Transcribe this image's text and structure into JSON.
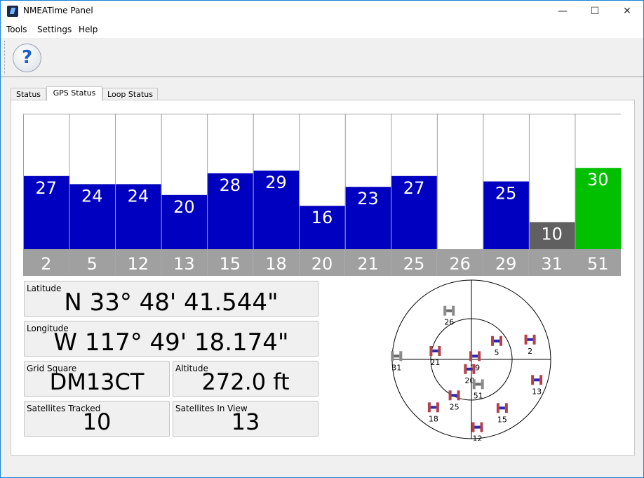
{
  "window": {
    "title": "NMEATime Panel",
    "controls": {
      "minimize": "—",
      "maximize": "☐",
      "close": "✕"
    }
  },
  "menu": {
    "tools": "Tools",
    "settings": "Settings",
    "help": "Help"
  },
  "toolbar": {
    "help_glyph": "?"
  },
  "tabs": [
    {
      "label": "Status"
    },
    {
      "label": "GPS Status"
    },
    {
      "label": "Loop Status"
    }
  ],
  "colors": {
    "bar_used": "#0000c0",
    "bar_tracked_unused": "#606060",
    "bar_selected": "#00c000",
    "prn_row": "#a0a0a0",
    "sat_used": "#b5414b",
    "sat_unused": "#8a8a8a"
  },
  "chart_data": {
    "type": "bar",
    "categories": [
      "2",
      "5",
      "12",
      "13",
      "15",
      "18",
      "20",
      "21",
      "25",
      "26",
      "29",
      "31",
      "51"
    ],
    "values": [
      27,
      24,
      24,
      20,
      28,
      29,
      16,
      23,
      27,
      0,
      25,
      10,
      30
    ],
    "value_labels": [
      "27",
      "24",
      "24",
      "20",
      "28",
      "29",
      "16",
      "23",
      "27",
      "",
      "25",
      "10",
      "30"
    ],
    "status": [
      "used",
      "used",
      "used",
      "used",
      "used",
      "used",
      "used",
      "used",
      "used",
      "none",
      "used",
      "tracked",
      "selected"
    ],
    "ylim": [
      0,
      50
    ]
  },
  "position": {
    "latitude_label": "Latitude",
    "latitude": "N 33° 48' 41.544\"",
    "longitude_label": "Longitude",
    "longitude": "W 117° 49' 18.174\"",
    "grid_label": "Grid Square",
    "grid": "DM13CT",
    "altitude_label": "Altitude",
    "altitude": "272.0 ft",
    "tracked_label": "Satellites Tracked",
    "tracked": "10",
    "inview_label": "Satellites In View",
    "inview": "13"
  },
  "skyplot": {
    "satellites": [
      {
        "prn": "26",
        "az": 335,
        "el": 30,
        "used": false
      },
      {
        "prn": "5",
        "az": 55,
        "el": 55,
        "used": true
      },
      {
        "prn": "2",
        "az": 72,
        "el": 20,
        "used": true
      },
      {
        "prn": "31",
        "az": 272,
        "el": 5,
        "used": false
      },
      {
        "prn": "21",
        "az": 282,
        "el": 48,
        "used": true
      },
      {
        "prn": "29",
        "az": 55,
        "el": 85,
        "used": true
      },
      {
        "prn": "20",
        "az": 190,
        "el": 78,
        "used": true
      },
      {
        "prn": "13",
        "az": 108,
        "el": 12,
        "used": true
      },
      {
        "prn": "51",
        "az": 165,
        "el": 60,
        "used": false
      },
      {
        "prn": "25",
        "az": 205,
        "el": 44,
        "used": true
      },
      {
        "prn": "18",
        "az": 218,
        "el": 20,
        "used": true
      },
      {
        "prn": "15",
        "az": 148,
        "el": 24,
        "used": true
      },
      {
        "prn": "12",
        "az": 175,
        "el": 12,
        "used": true
      }
    ]
  }
}
